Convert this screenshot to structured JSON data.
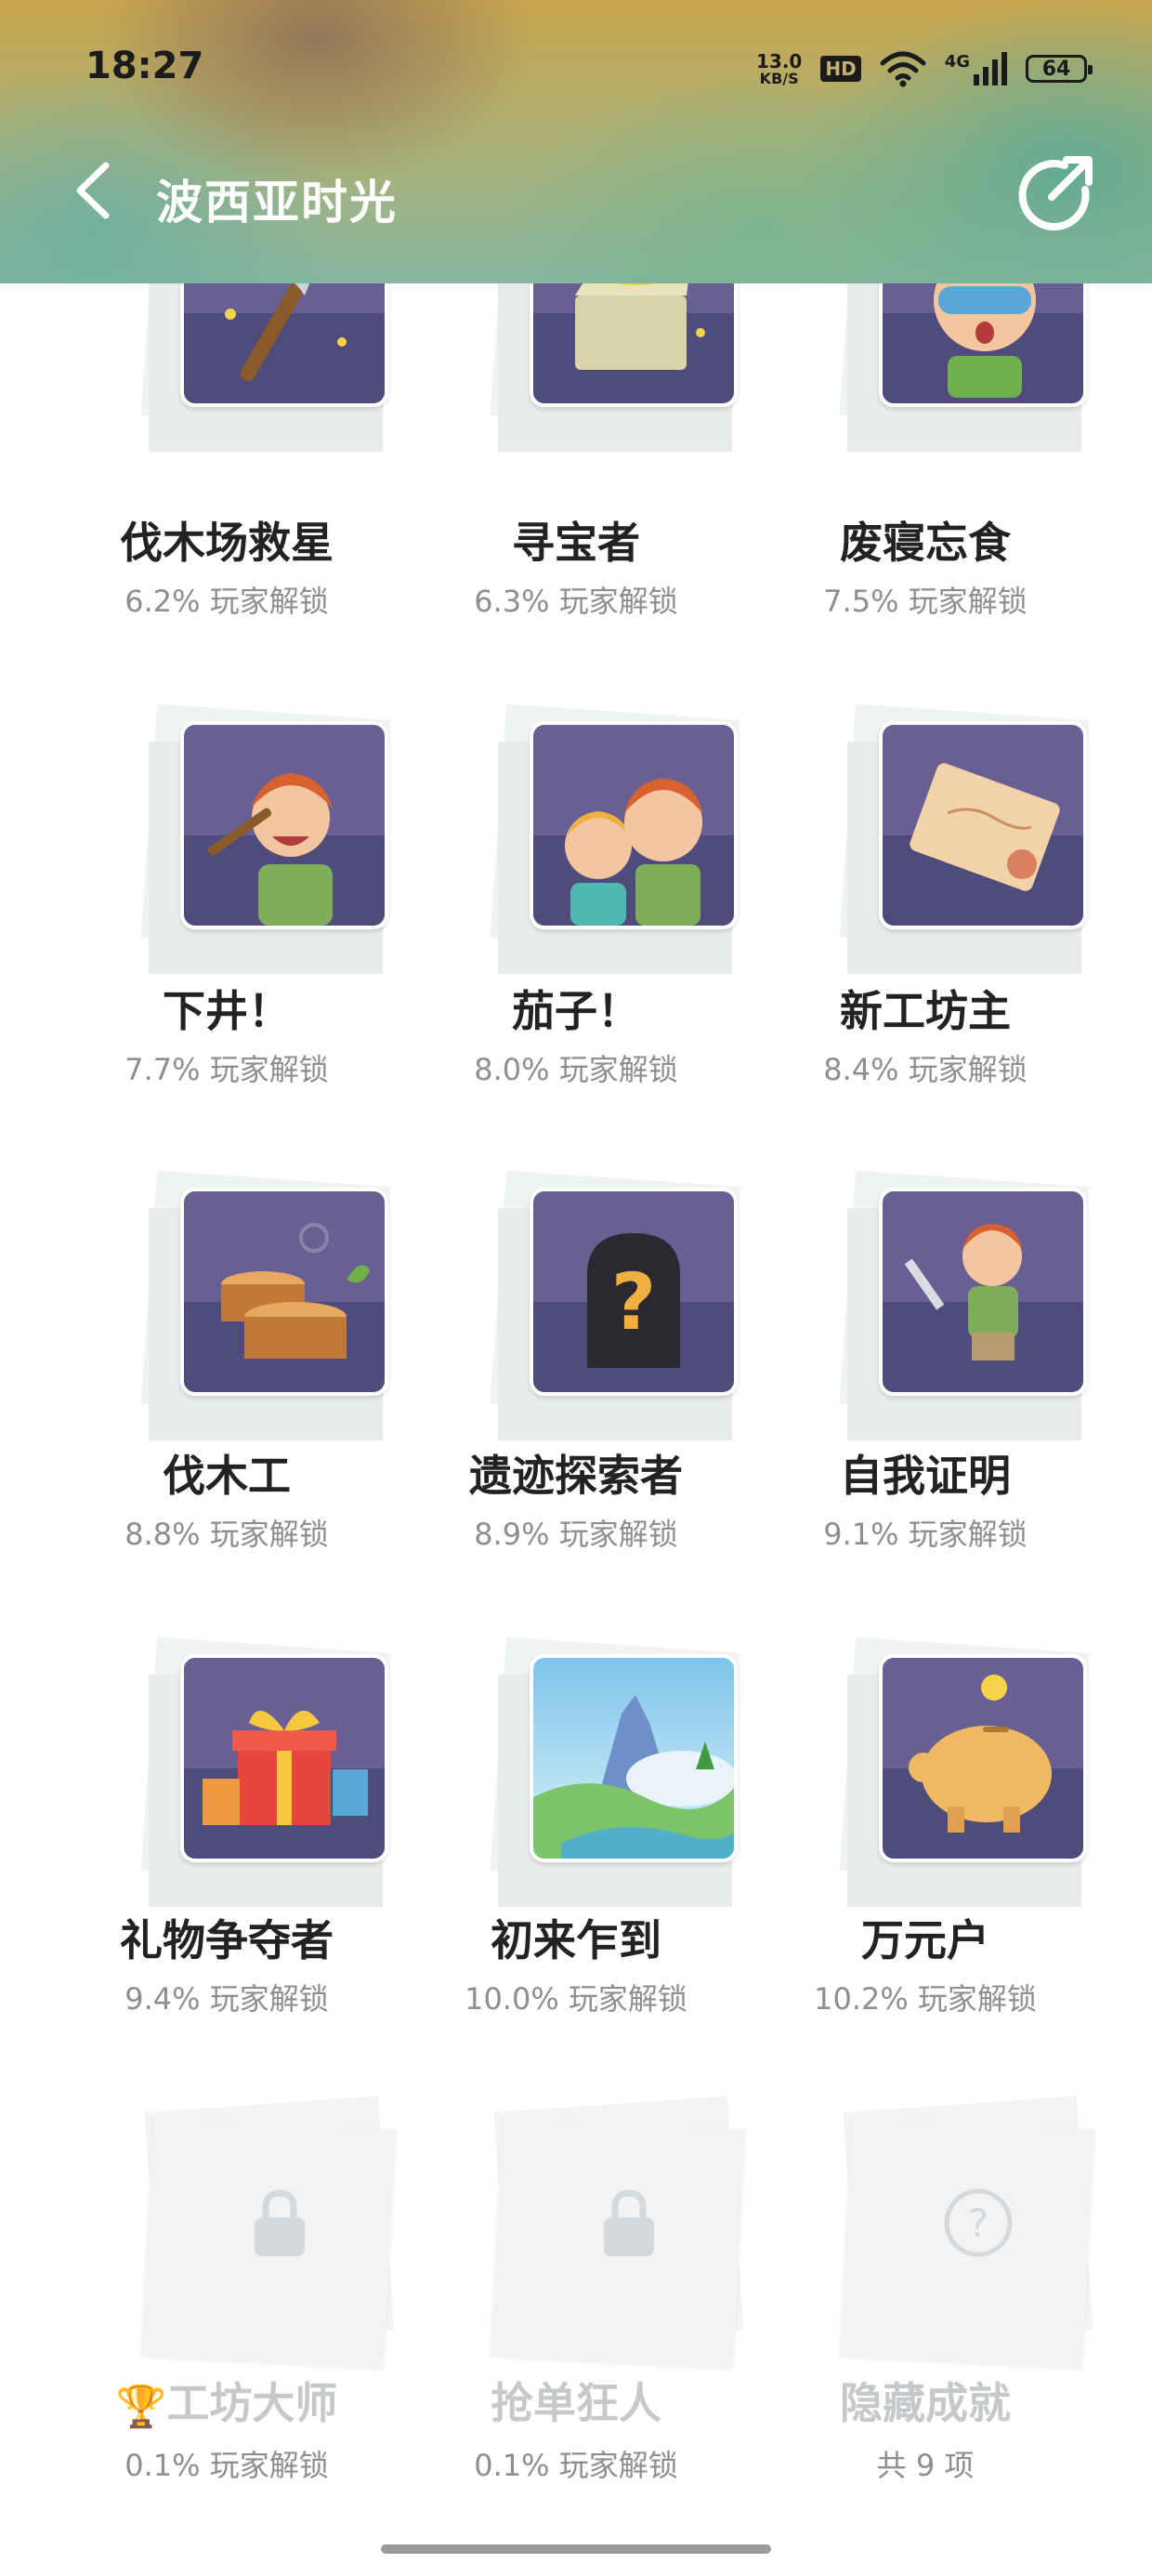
{
  "status_bar": {
    "time": "18:27",
    "speed_value": "13.0",
    "speed_unit": "KB/S",
    "hd": "HD",
    "network": "4G",
    "battery": "64"
  },
  "header": {
    "title": "波西亚时光"
  },
  "achievements": [
    {
      "name": "伐木场救星",
      "percent": "6.2% 玩家解锁",
      "icon": "axe-icon"
    },
    {
      "name": "寻宝者",
      "percent": "6.3% 玩家解锁",
      "icon": "treasure-chest-icon"
    },
    {
      "name": "废寝忘食",
      "percent": "7.5% 玩家解锁",
      "icon": "sleep-mask-icon"
    },
    {
      "name": "下井！",
      "percent": "7.7% 玩家解锁",
      "icon": "miner-icon"
    },
    {
      "name": "茄子！",
      "percent": "8.0% 玩家解锁",
      "icon": "selfie-icon"
    },
    {
      "name": "新工坊主",
      "percent": "8.4% 玩家解锁",
      "icon": "deed-icon"
    },
    {
      "name": "伐木工",
      "percent": "8.8% 玩家解锁",
      "icon": "tree-stump-icon"
    },
    {
      "name": "遗迹探索者",
      "percent": "8.9% 玩家解锁",
      "icon": "ruins-question-icon"
    },
    {
      "name": "自我证明",
      "percent": "9.1% 玩家解锁",
      "icon": "sword-boy-icon"
    },
    {
      "name": "礼物争夺者",
      "percent": "9.4% 玩家解锁",
      "icon": "gift-icon"
    },
    {
      "name": "初来乍到",
      "percent": "10.0% 玩家解锁",
      "icon": "landscape-icon"
    },
    {
      "name": "万元户",
      "percent": "10.2% 玩家解锁",
      "icon": "piggy-bank-icon"
    },
    {
      "name": "工坊大师",
      "percent": "0.1% 玩家解锁",
      "icon": "lock-icon",
      "locked": true
    },
    {
      "name": "抢单狂人",
      "percent": "0.1% 玩家解锁",
      "icon": "lock-icon",
      "locked": true
    },
    {
      "name": "隐藏成就",
      "percent": "共 9 项",
      "icon": "question-circle-icon",
      "locked": true
    }
  ]
}
